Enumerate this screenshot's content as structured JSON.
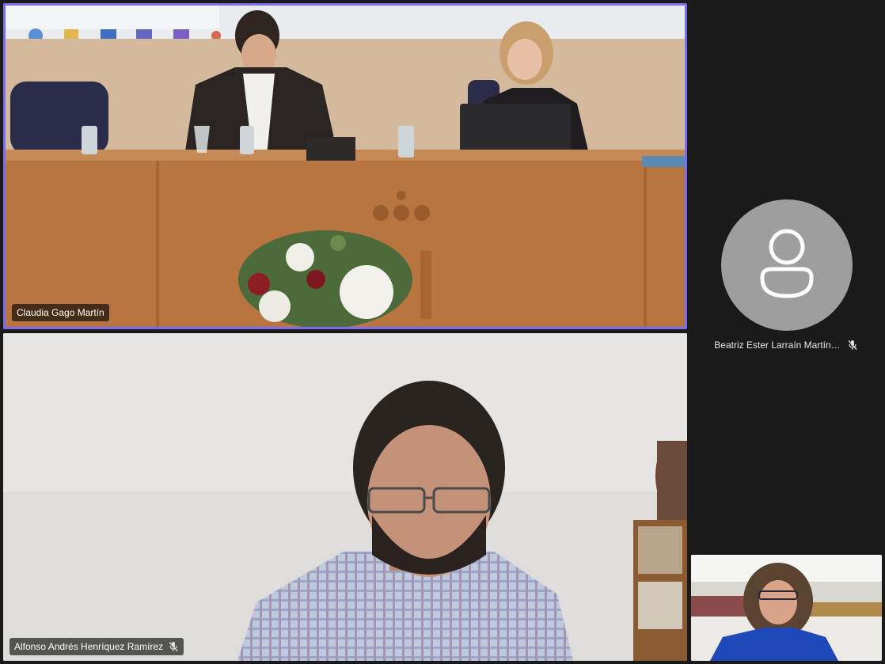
{
  "participants": {
    "stage": {
      "name": "Claudia Gago Martín",
      "active_speaker": true
    },
    "alfonso": {
      "name": "Alfonso Andrés Henríquez Ramírez",
      "muted": true
    },
    "beatriz": {
      "name": "Beatriz Ester Larraín Martín…",
      "muted": true,
      "avatar_icon": "person-icon"
    },
    "self_view": {
      "name": ""
    }
  },
  "colors": {
    "background": "#1a1a1a",
    "active_speaker_border": "#7b6cf0",
    "avatar_bg": "#9e9e9e",
    "name_tag_bg": "rgba(0,0,0,0.62)"
  }
}
